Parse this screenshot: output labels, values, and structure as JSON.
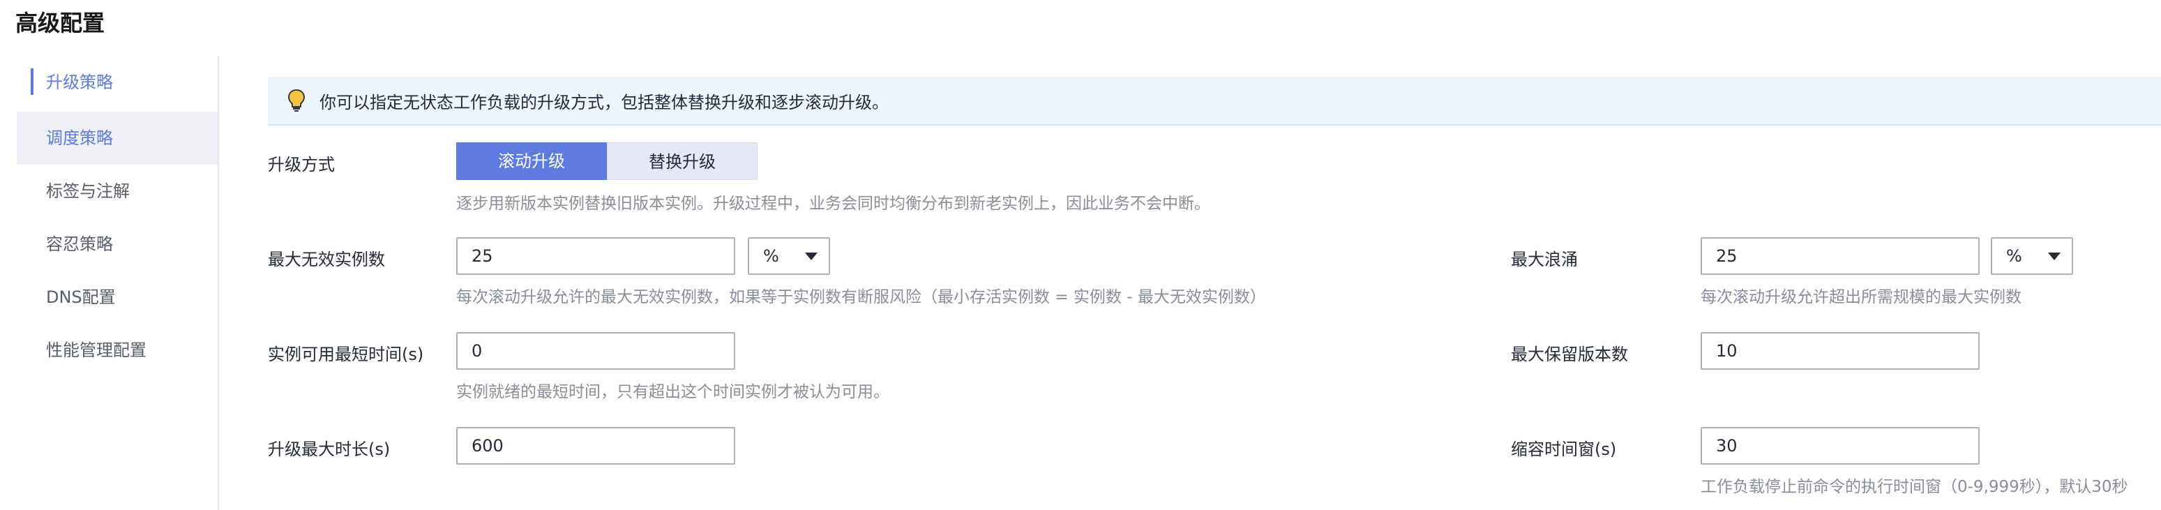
{
  "page": {
    "title": "高级配置"
  },
  "sidebar": {
    "items": [
      {
        "label": "升级策略"
      },
      {
        "label": "调度策略"
      },
      {
        "label": "标签与注解"
      },
      {
        "label": "容忍策略"
      },
      {
        "label": "DNS配置"
      },
      {
        "label": "性能管理配置"
      }
    ]
  },
  "tip": {
    "icon": "lightbulb-icon",
    "text": "你可以指定无状态工作负载的升级方式，包括整体替换升级和逐步滚动升级。"
  },
  "upgrade_mode": {
    "label": "升级方式",
    "options": [
      "滚动升级",
      "替换升级"
    ],
    "selected": "滚动升级",
    "hint": "逐步用新版本实例替换旧版本实例。升级过程中，业务会同时均衡分布到新老实例上，因此业务不会中断。"
  },
  "max_unavailable": {
    "label": "最大无效实例数",
    "value": "25",
    "unit": "%",
    "hint": "每次滚动升级允许的最大无效实例数，如果等于实例数有断服风险（最小存活实例数 = 实例数 - 最大无效实例数）"
  },
  "max_surge": {
    "label": "最大浪涌",
    "value": "25",
    "unit": "%",
    "hint": "每次滚动升级允许超出所需规模的最大实例数"
  },
  "min_ready": {
    "label": "实例可用最短时间(s)",
    "value": "0",
    "hint": "实例就绪的最短时间，只有超出这个时间实例才被认为可用。"
  },
  "revision_history": {
    "label": "最大保留版本数",
    "value": "10"
  },
  "progress_deadline": {
    "label": "升级最大时长(s)",
    "value": "600"
  },
  "scale_in_window": {
    "label": "缩容时间窗(s)",
    "value": "30",
    "hint": "工作负载停止前命令的执行时间窗（0-9,999秒），默认30秒"
  },
  "colors": {
    "accent": "#5e7ce0",
    "tip_bg": "#edf6ff",
    "hint": "#8a8e99"
  }
}
